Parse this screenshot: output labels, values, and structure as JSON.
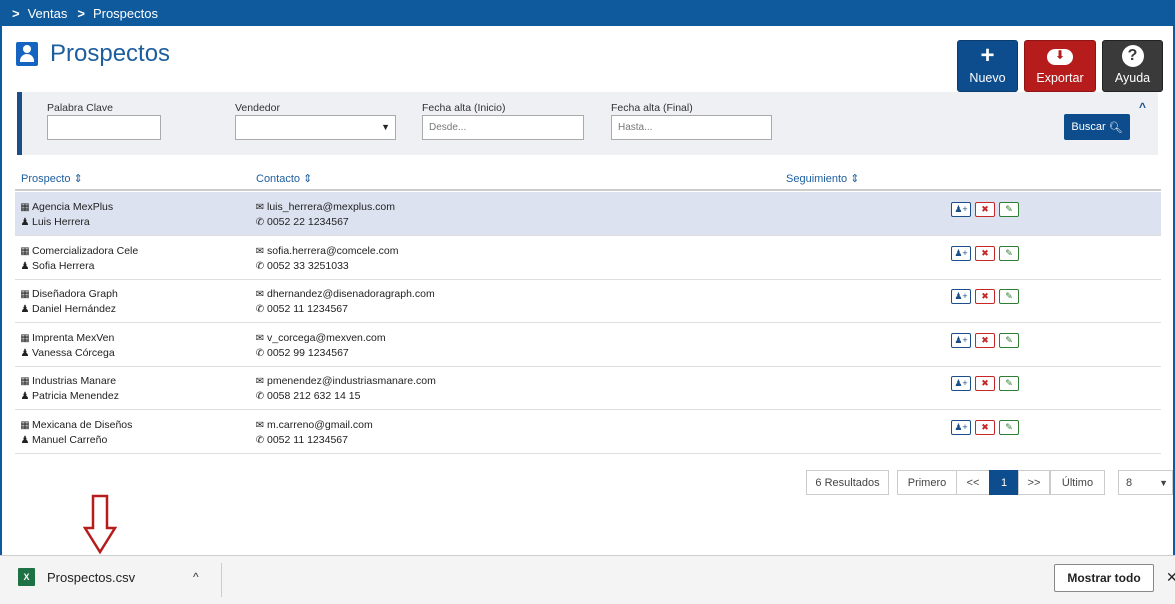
{
  "breadcrumb": [
    "Ventas",
    "Prospectos"
  ],
  "page_title": "Prospectos",
  "actions": {
    "new": "Nuevo",
    "export": "Exportar",
    "help": "Ayuda"
  },
  "filters": {
    "keyword_label": "Palabra Clave",
    "seller_label": "Vendedor",
    "start_label": "Fecha alta (Inicio)",
    "start_placeholder": "Desde...",
    "end_label": "Fecha alta (Final)",
    "end_placeholder": "Hasta...",
    "search_button": "Buscar"
  },
  "columns": {
    "prospect": "Prospecto",
    "contact": "Contacto",
    "followup": "Seguimiento"
  },
  "rows": [
    {
      "company": "Agencia MexPlus",
      "person": "Luis Herrera",
      "email": "luis_herrera@mexplus.com",
      "phone": "0052 22 1234567",
      "selected": true
    },
    {
      "company": "Comercializadora Cele",
      "person": "Sofia Herrera",
      "email": "sofia.herrera@comcele.com",
      "phone": "0052 33 3251033"
    },
    {
      "company": "Diseñadora Graph",
      "person": "Daniel Hernández",
      "email": "dhernandez@disenadoragraph.com",
      "phone": "0052 11 1234567"
    },
    {
      "company": "Imprenta MexVen",
      "person": "Vanessa Córcega",
      "email": "v_corcega@mexven.com",
      "phone": "0052 99 1234567"
    },
    {
      "company": "Industrias Manare",
      "person": "Patricia Menendez",
      "email": "pmenendez@industriasmanare.com",
      "phone": "0058 212 632 14 15"
    },
    {
      "company": "Mexicana de Diseños",
      "person": "Manuel Carreño",
      "email": "m.carreno@gmail.com",
      "phone": "0052 11 1234567"
    }
  ],
  "pagination": {
    "results": "6 Resultados",
    "first": "Primero",
    "prev": "<<",
    "current": "1",
    "next": ">>",
    "last": "Último",
    "page_size": "8"
  },
  "download": {
    "filename": "Prospectos.csv",
    "show_all": "Mostrar todo"
  }
}
